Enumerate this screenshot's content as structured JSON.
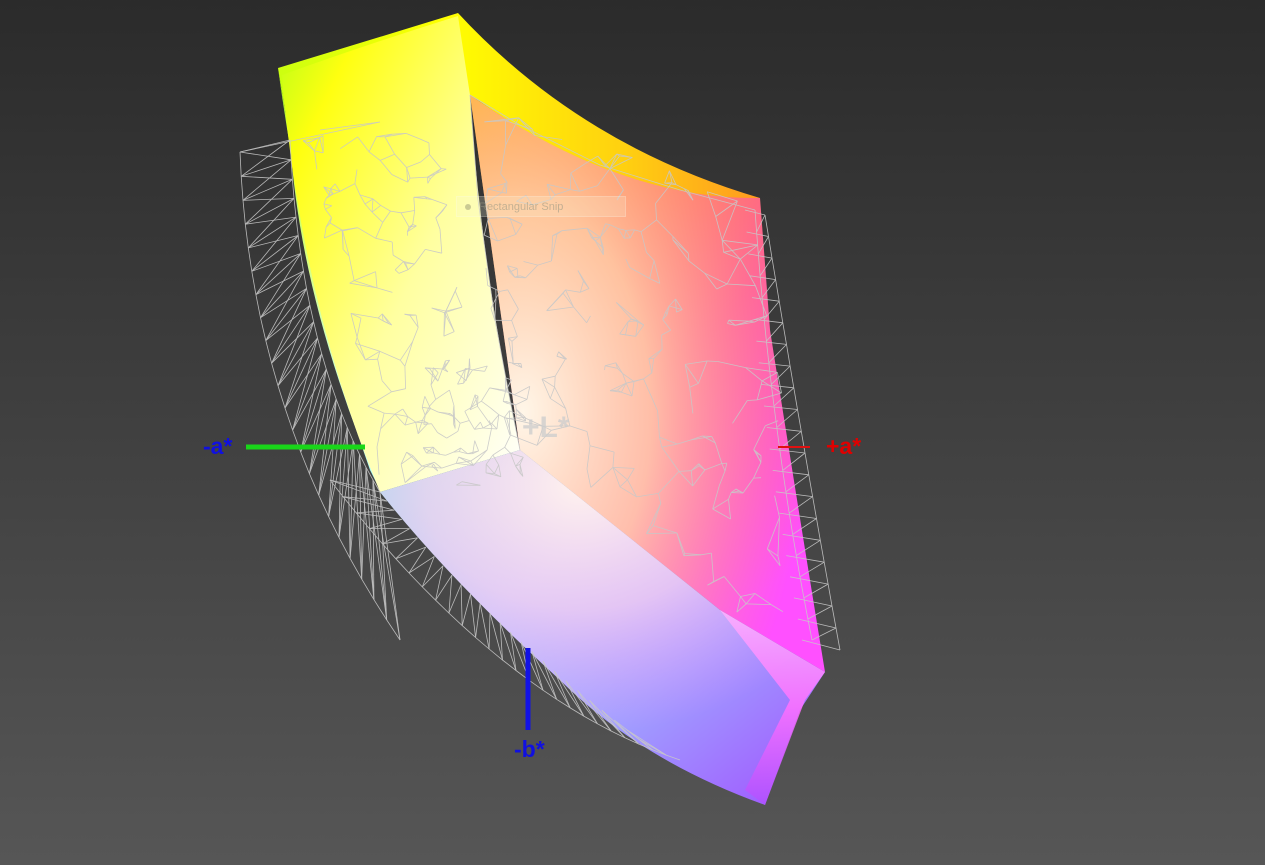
{
  "axes": {
    "minus_a": {
      "label": "-a*",
      "color": "#1010e0"
    },
    "plus_a": {
      "label": "+a*",
      "color": "#e00000"
    },
    "minus_b": {
      "label": "-b*",
      "color": "#1010e0"
    },
    "plus_l": {
      "label": "+L*",
      "color": "#cdcdcd"
    },
    "neg_a_line_color": "#19d619",
    "pos_a_line_color": "#e01010",
    "neg_b_line_color": "#1212e6"
  },
  "tooltip": {
    "text": "Rectangular Snip"
  },
  "colors": {
    "background_top": "#2b2b2b",
    "background_bottom": "#565656",
    "wireframe": "#c8c8c8",
    "gamut_yellow": "#ffff00",
    "gamut_orange": "#ffa020",
    "gamut_red": "#ff3060",
    "gamut_magenta": "#ff40ff",
    "gamut_violet": "#9a50ff",
    "gamut_blue": "#8aa8ff",
    "gamut_cyan": "#90ffe0",
    "gamut_green": "#9aff30",
    "gamut_white": "#fffff0"
  }
}
